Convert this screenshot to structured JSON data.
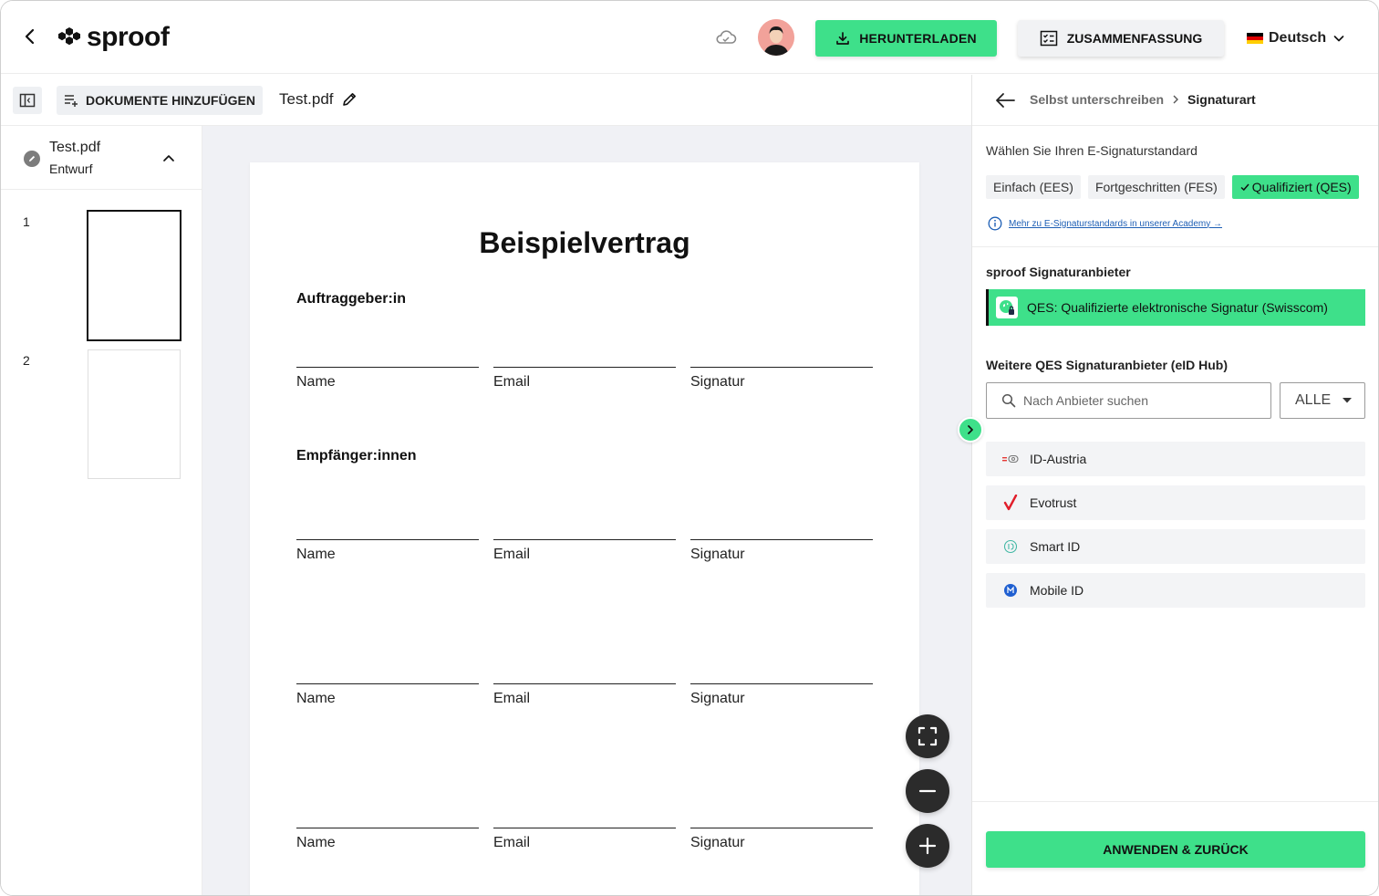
{
  "app": {
    "brand": "sproof"
  },
  "header": {
    "download_label": "HERUNTERLADEN",
    "summary_label": "ZUSAMMENFASSUNG",
    "language": "Deutsch"
  },
  "toolbar": {
    "add_documents_label": "DOKUMENTE HINZUFÜGEN",
    "document_title": "Test.pdf"
  },
  "sidebar": {
    "file_name": "Test.pdf",
    "file_state": "Entwurf",
    "pages": [
      {
        "number": "1",
        "active": true
      },
      {
        "number": "2",
        "active": false
      }
    ]
  },
  "document": {
    "title": "Beispielvertrag",
    "section_client": "Auftraggeber:in",
    "section_recipients": "Empfänger:innen",
    "field_name": "Name",
    "field_email": "Email",
    "field_signature": "Signatur"
  },
  "panel": {
    "breadcrumb_parent": "Selbst unterschreiben",
    "breadcrumb_current": "Signaturart",
    "standard_label": "Wählen Sie Ihren E-Signaturstandard",
    "standards": [
      {
        "label": "Einfach (EES)",
        "selected": false
      },
      {
        "label": "Fortgeschritten (FES)",
        "selected": false
      },
      {
        "label": "Qualifiziert (QES)",
        "selected": true
      }
    ],
    "academy_link": "Mehr zu E-Signaturstandards in unserer Academy →",
    "sproof_providers_title": "sproof Signaturanbieter",
    "primary_provider": "QES: Qualifizierte elektronische Signatur (Swisscom)",
    "more_providers_title": "Weitere QES Signaturanbieter (eID Hub)",
    "search_placeholder": "Nach Anbieter suchen",
    "filter_value": "ALLE",
    "providers": [
      "ID-Austria",
      "Evotrust",
      "Smart ID",
      "Mobile ID"
    ],
    "apply_label": "ANWENDEN & ZURÜCK"
  },
  "colors": {
    "accent": "#3ee08a",
    "dark_button": "#2b2b2b",
    "canvas_bg": "#f0f1f5",
    "link": "#1e5fb5"
  }
}
